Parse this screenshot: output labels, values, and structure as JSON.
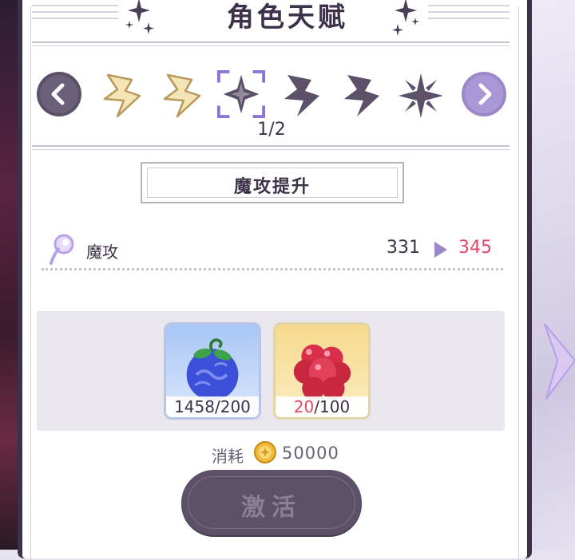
{
  "header": {
    "title": "角色天赋"
  },
  "talents": {
    "page_indicator": "1/2",
    "items": [
      {
        "state": "active"
      },
      {
        "state": "active"
      },
      {
        "state": "selected"
      },
      {
        "state": "locked"
      },
      {
        "state": "locked"
      },
      {
        "state": "locked"
      }
    ]
  },
  "skill": {
    "name": "魔攻提升"
  },
  "stat": {
    "label": "魔攻",
    "current": "331",
    "next": "345"
  },
  "materials": [
    {
      "name": "blue-fruit-icon",
      "have": "1458",
      "need": "/200"
    },
    {
      "name": "red-fruit-icon",
      "have": "20",
      "need": "/100"
    }
  ],
  "cost": {
    "label": "消耗",
    "value": "50000"
  },
  "activate": {
    "label": "激活"
  },
  "colors": {
    "accent": "#9a88c8",
    "increase": "#e4466a",
    "panel": "#3c3148"
  }
}
